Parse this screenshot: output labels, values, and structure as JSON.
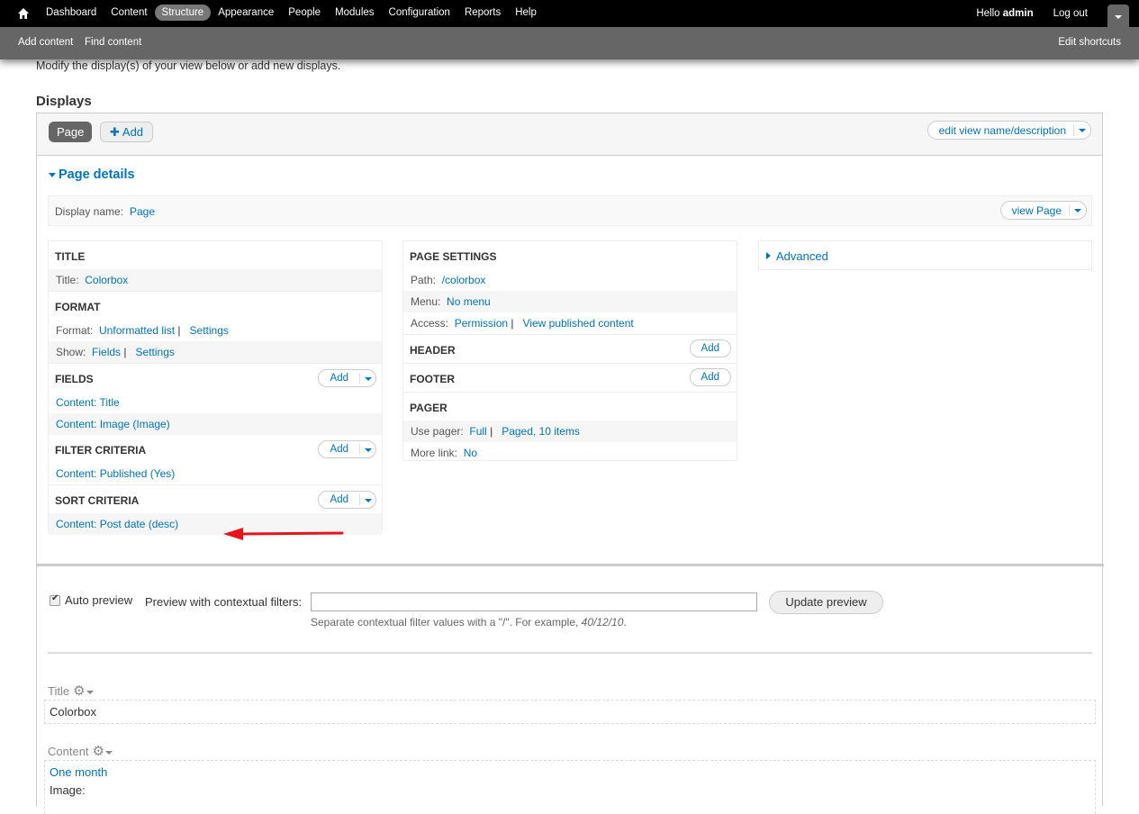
{
  "toolbar": {
    "menu": [
      "Dashboard",
      "Content",
      "Structure",
      "Appearance",
      "People",
      "Modules",
      "Configuration",
      "Reports",
      "Help"
    ],
    "active": "Structure",
    "hello": "Hello",
    "username": "admin",
    "logout": "Log out",
    "shortcuts": [
      "Add content",
      "Find content"
    ],
    "edit_shortcuts": "Edit shortcuts"
  },
  "intro": "Modify the display(s) of your view below or add new displays.",
  "displays_heading": "Displays",
  "tabs": {
    "page": "Page",
    "add": "Add"
  },
  "edit_view": "edit view name/description",
  "page_details": "Page details",
  "display_name": {
    "label": "Display name:",
    "value": "Page"
  },
  "view_page": "view Page",
  "col1": {
    "title": {
      "heading": "TITLE",
      "label": "Title:",
      "value": "Colorbox"
    },
    "format": {
      "heading": "FORMAT",
      "format_label": "Format:",
      "format_value": "Unformatted list",
      "format_settings": "Settings",
      "show_label": "Show:",
      "show_value": "Fields",
      "show_settings": "Settings"
    },
    "fields": {
      "heading": "FIELDS",
      "add": "Add",
      "items": [
        "Content: Title",
        "Content: Image (Image)"
      ]
    },
    "filter": {
      "heading": "FILTER CRITERIA",
      "add": "Add",
      "items": [
        "Content: Published (Yes)"
      ]
    },
    "sort": {
      "heading": "SORT CRITERIA",
      "add": "Add",
      "items": [
        "Content: Post date (desc)"
      ]
    }
  },
  "col2": {
    "page_settings": {
      "heading": "PAGE SETTINGS",
      "path_label": "Path:",
      "path_value": "/colorbox",
      "menu_label": "Menu:",
      "menu_value": "No menu",
      "access_label": "Access:",
      "access_value": "Permission",
      "access_value2": "View published content"
    },
    "header": {
      "heading": "HEADER",
      "add": "Add"
    },
    "footer": {
      "heading": "FOOTER",
      "add": "Add"
    },
    "pager": {
      "heading": "PAGER",
      "use_label": "Use pager:",
      "use_value": "Full",
      "use_value2": "Paged, 10 items",
      "more_label": "More link:",
      "more_value": "No"
    }
  },
  "advanced": "Advanced",
  "separator": "|",
  "preview": {
    "auto_preview": "Auto preview",
    "auto_preview_checked": true,
    "ctx_label": "Preview with contextual filters:",
    "ctx_value": "",
    "help_prefix": "Separate contextual filter values with a \"/\". For example, ",
    "help_example": "40/12/10",
    "help_suffix": ".",
    "update": "Update preview",
    "title_label": "Title",
    "title_value": "Colorbox",
    "content_label": "Content",
    "content_link": "One month",
    "content_image": "Image:"
  }
}
